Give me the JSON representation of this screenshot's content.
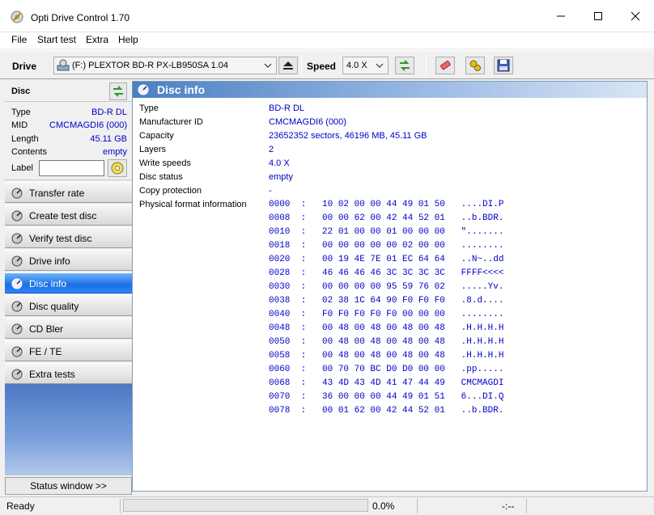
{
  "window": {
    "title": "Opti Drive Control 1.70"
  },
  "menu": [
    "File",
    "Start test",
    "Extra",
    "Help"
  ],
  "toolbar": {
    "drive_label": "Drive",
    "drive_value": "(F:)   PLEXTOR BD-R  PX-LB950SA 1.04",
    "speed_label": "Speed",
    "speed_value": "4.0 X"
  },
  "disc_panel": {
    "header": "Disc",
    "props": [
      {
        "key": "Type",
        "value": "BD-R DL"
      },
      {
        "key": "MID",
        "value": "CMCMAGDI6 (000)"
      },
      {
        "key": "Length",
        "value": "45.11 GB"
      },
      {
        "key": "Contents",
        "value": "empty"
      }
    ],
    "label_key": "Label",
    "label_value": ""
  },
  "nav": [
    "Transfer rate",
    "Create test disc",
    "Verify test disc",
    "Drive info",
    "Disc info",
    "Disc quality",
    "CD Bler",
    "FE / TE",
    "Extra tests"
  ],
  "nav_active": "Disc info",
  "status_button": "Status window >>",
  "main": {
    "title": "Disc info",
    "rows": [
      {
        "key": "Type",
        "value": "BD-R DL"
      },
      {
        "key": "Manufacturer ID",
        "value": "CMCMAGDI6 (000)"
      },
      {
        "key": "Capacity",
        "value": "23652352 sectors, 46196 MB, 45.11 GB"
      },
      {
        "key": "Layers",
        "value": "2"
      },
      {
        "key": "Write speeds",
        "value": "4.0 X"
      },
      {
        "key": "Disc status",
        "value": "empty"
      },
      {
        "key": "Copy protection",
        "value": "-"
      },
      {
        "key": "Physical format information",
        "value": ""
      }
    ],
    "hex": [
      "0000  :   10 02 00 00 44 49 01 50   ....DI.P",
      "0008  :   00 00 62 00 42 44 52 01   ..b.BDR.",
      "0010  :   22 01 00 00 01 00 00 00   \".......",
      "0018  :   00 00 00 00 00 02 00 00   ........",
      "0020  :   00 19 4E 7E 01 EC 64 64   ..N~..dd",
      "0028  :   46 46 46 46 3C 3C 3C 3C   FFFF<<<<",
      "0030  :   00 00 00 00 95 59 76 02   .....Yv.",
      "0038  :   02 38 1C 64 90 F0 F0 F0   .8.d....",
      "0040  :   F0 F0 F0 F0 F0 00 00 00   ........",
      "0048  :   00 48 00 48 00 48 00 48   .H.H.H.H",
      "0050  :   00 48 00 48 00 48 00 48   .H.H.H.H",
      "0058  :   00 48 00 48 00 48 00 48   .H.H.H.H",
      "0060  :   00 70 70 BC D0 D0 00 00   .pp.....",
      "0068  :   43 4D 43 4D 41 47 44 49   CMCMAGDI",
      "0070  :   36 00 00 00 44 49 01 51   6...DI.Q",
      "0078  :   00 01 62 00 42 44 52 01   ..b.BDR."
    ]
  },
  "statusbar": {
    "text": "Ready",
    "progress": "0.0%",
    "progress_value": 0.0,
    "time": "-:--"
  }
}
